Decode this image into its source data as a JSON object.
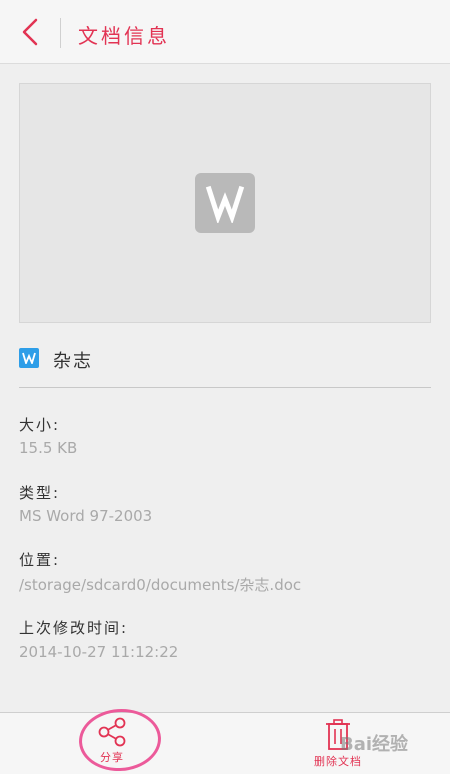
{
  "header": {
    "title": "文档信息",
    "back_icon": "chevron-left-icon",
    "accent_color": "#e23353"
  },
  "preview": {
    "icon": "word-doc-icon"
  },
  "document": {
    "name": "杂志",
    "type_icon": "word-doc-icon"
  },
  "fields": {
    "size_label": "大小:",
    "size_value": "15.5 KB",
    "type_label": "类型:",
    "type_value": "MS Word 97-2003",
    "location_label": "位置:",
    "location_value": "/storage/sdcard0/documents/杂志.doc",
    "modified_label": "上次修改时间:",
    "modified_value": "2014-10-27 11:12:22"
  },
  "bottom_bar": {
    "share_label": "分享",
    "share_icon": "share-icon",
    "delete_label": "删除文档",
    "delete_icon": "trash-icon"
  },
  "watermark": {
    "text": "Bai经验"
  }
}
